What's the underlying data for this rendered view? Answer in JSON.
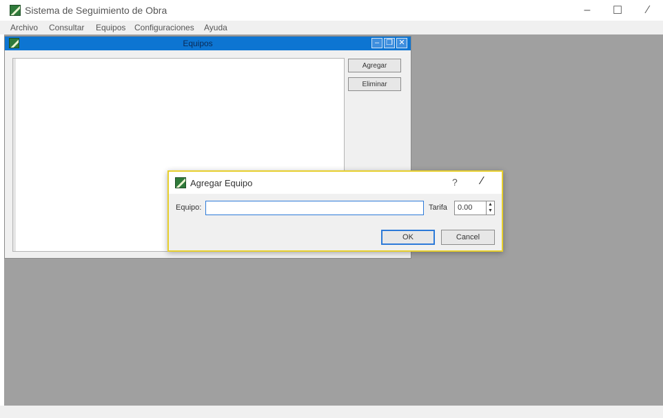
{
  "window": {
    "title": "Sistema de Seguimiento de Obra",
    "controls": {
      "minimize": "–",
      "maximize": "☐",
      "close": "⁄"
    }
  },
  "menu": [
    "Archivo",
    "Consultar",
    "Equipos",
    "Configuraciones",
    "Ayuda"
  ],
  "child_window": {
    "title": "Equipos",
    "buttons": {
      "add": "Agregar",
      "delete": "Eliminar"
    },
    "controls": {
      "minimize": "–",
      "maximize": "❐",
      "close": "✕"
    }
  },
  "dialog": {
    "title": "Agregar Equipo",
    "help": "?",
    "close": "⁄",
    "equipo_label": "Equipo:",
    "equipo_value": "",
    "tarifa_label": "Tarifa",
    "tarifa_value": "0.00",
    "ok": "OK",
    "cancel": "Cancel"
  },
  "colors": {
    "accent": "#0d75d2",
    "dialog_border": "#e7cf2c",
    "mdi_background": "#a0a0a0"
  },
  "icons": [
    "app-logo-icon",
    "minimize-icon",
    "maximize-icon",
    "close-icon",
    "help-icon",
    "spin-arrows-icon"
  ]
}
